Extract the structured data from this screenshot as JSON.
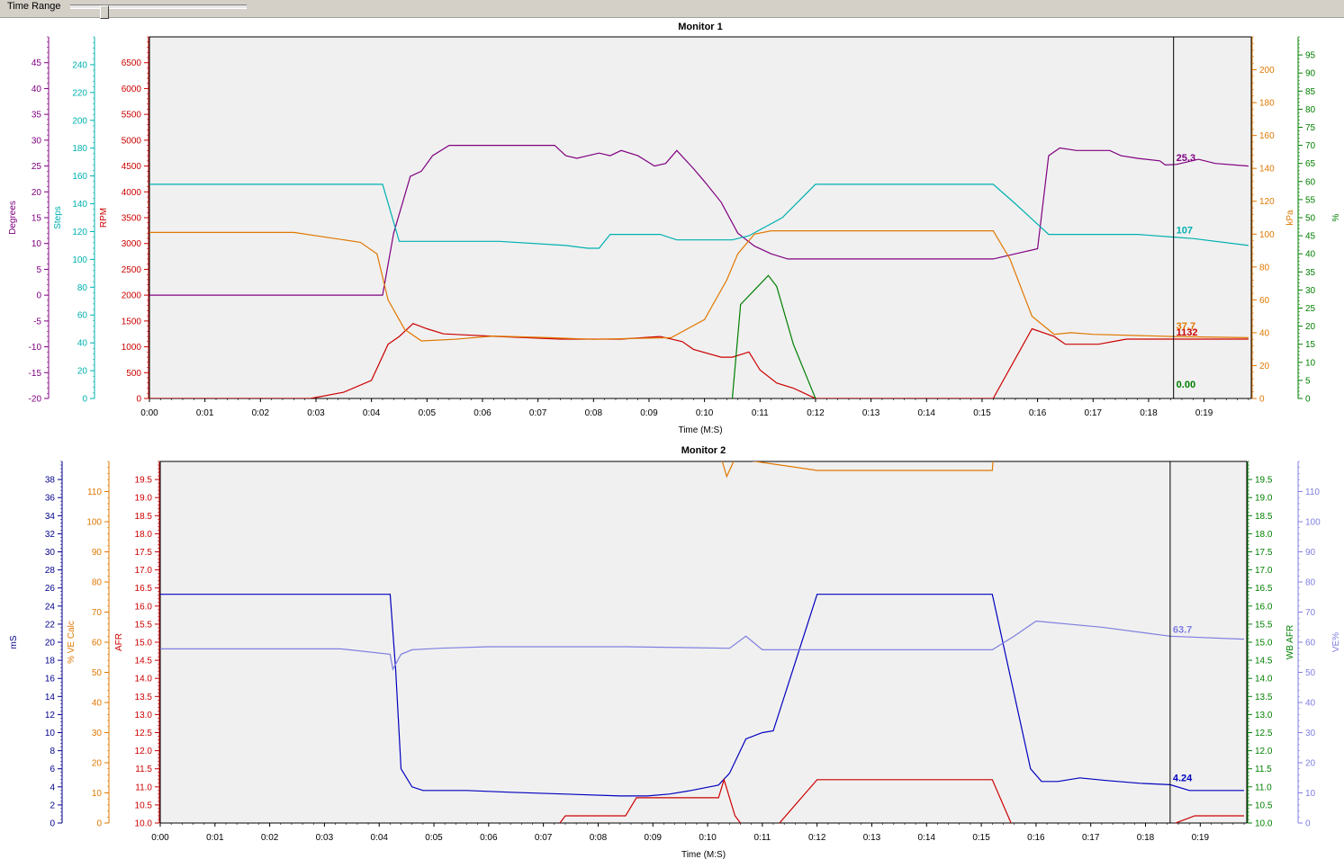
{
  "toolbar": {
    "time_range_label": "Time Range",
    "slider_value": 0.18
  },
  "chart_data": [
    {
      "type": "line",
      "title": "Monitor 1",
      "xlabel": "Time (M:S)",
      "x_ticks": [
        "0:00",
        "0:01",
        "0:02",
        "0:03",
        "0:04",
        "0:05",
        "0:06",
        "0:07",
        "0:08",
        "0:09",
        "0:10",
        "0:11",
        "0:12",
        "0:13",
        "0:14",
        "0:15",
        "0:16",
        "0:17",
        "0:18",
        "0:19"
      ],
      "xlim": [
        0,
        19.85
      ],
      "cursor_x": 18.45,
      "grid": false,
      "axes": [
        {
          "id": "deg",
          "label": "Degrees",
          "side": "left",
          "color": "#800080",
          "min": -20,
          "max": 50,
          "ticks": [
            -20,
            -15,
            -10,
            -5,
            0,
            5,
            10,
            15,
            20,
            25,
            30,
            35,
            40,
            45
          ]
        },
        {
          "id": "steps",
          "label": "Steps",
          "side": "left",
          "color": "#00b0b0",
          "min": 0,
          "max": 260,
          "ticks": [
            0,
            20,
            40,
            60,
            80,
            100,
            120,
            140,
            160,
            180,
            200,
            220,
            240
          ]
        },
        {
          "id": "rpm",
          "label": "RPM",
          "side": "left",
          "color": "#cc0000",
          "min": 0,
          "max": 7000,
          "ticks": [
            0,
            500,
            1000,
            1500,
            2000,
            2500,
            3000,
            3500,
            4000,
            4500,
            5000,
            5500,
            6000,
            6500
          ]
        },
        {
          "id": "kpa",
          "label": "kPa",
          "side": "right",
          "color": "#e07800",
          "min": 0,
          "max": 220,
          "ticks": [
            0,
            20,
            40,
            60,
            80,
            100,
            120,
            140,
            160,
            180,
            200
          ]
        },
        {
          "id": "pct",
          "label": "%",
          "side": "right",
          "color": "#007f00",
          "min": 0,
          "max": 100,
          "ticks": [
            0,
            5,
            10,
            15,
            20,
            25,
            30,
            35,
            40,
            45,
            50,
            55,
            60,
            65,
            70,
            75,
            80,
            85,
            90,
            95
          ]
        }
      ],
      "series": [
        {
          "axis": "deg",
          "color": "#800080",
          "cursor_value": "25.3",
          "cursor_dy": 0,
          "x": [
            0,
            4.2,
            4.4,
            4.7,
            4.9,
            5.1,
            5.4,
            7.3,
            7.5,
            7.7,
            7.9,
            8.1,
            8.3,
            8.5,
            8.8,
            9.1,
            9.3,
            9.5,
            9.8,
            10.0,
            10.3,
            10.6,
            10.9,
            11.2,
            11.5,
            12,
            13,
            14,
            15.2,
            15.6,
            16.0,
            16.2,
            16.4,
            16.7,
            17.3,
            17.5,
            17.8,
            18.2,
            18.3,
            18.5,
            18.9,
            19.2,
            19.8
          ],
          "y": [
            0,
            0,
            12,
            23,
            24,
            27,
            29,
            29,
            27,
            26.5,
            27,
            27.5,
            27,
            28,
            27,
            25,
            25.5,
            28,
            24.5,
            22,
            18,
            12,
            9.5,
            8,
            7,
            7,
            7,
            7,
            7,
            8,
            9,
            27,
            28.5,
            28,
            28,
            27,
            26.5,
            26,
            25.2,
            25.3,
            26.3,
            25.5,
            25
          ]
        },
        {
          "axis": "steps",
          "color": "#00b0b0",
          "cursor_value": "107",
          "cursor_dy": 0,
          "x": [
            0,
            4.2,
            4.5,
            6.3,
            7.5,
            7.9,
            8.1,
            8.3,
            9.2,
            9.5,
            10.5,
            10.8,
            11.4,
            12,
            15.2,
            15.6,
            16.2,
            17.8,
            18.45,
            18.8,
            19.8
          ],
          "y": [
            154,
            154,
            113,
            113,
            110,
            108,
            108,
            118,
            118,
            114,
            114,
            117,
            130,
            154,
            154,
            140,
            118,
            118,
            116,
            115,
            110
          ]
        },
        {
          "axis": "rpm",
          "color": "#cc0000",
          "cursor_value": "1132",
          "cursor_dy": 0,
          "x": [
            0,
            2.9,
            3.5,
            4.0,
            4.3,
            4.5,
            4.75,
            5.0,
            5.3,
            6.3,
            7.4,
            8.5,
            9.2,
            9.6,
            9.8,
            10.3,
            10.5,
            10.8,
            11.0,
            11.3,
            11.6,
            12.0,
            15.2,
            15.9,
            16.3,
            16.5,
            17.1,
            17.6,
            18.45,
            19.8
          ],
          "y": [
            0,
            0,
            120,
            350,
            1050,
            1200,
            1450,
            1350,
            1250,
            1200,
            1150,
            1150,
            1200,
            1100,
            950,
            800,
            800,
            900,
            550,
            300,
            200,
            0,
            0,
            1350,
            1200,
            1050,
            1050,
            1150,
            1150,
            1150
          ]
        },
        {
          "axis": "kpa",
          "color": "#e07800",
          "cursor_value": "37.7",
          "cursor_dy": -4,
          "x": [
            0,
            2.6,
            3.8,
            4.1,
            4.3,
            4.6,
            4.9,
            5.5,
            6.2,
            7.2,
            8.0,
            9.4,
            10.0,
            10.4,
            10.6,
            10.9,
            11.2,
            12,
            15.2,
            15.5,
            15.9,
            16.3,
            16.6,
            17.0,
            18.45,
            19.8
          ],
          "y": [
            101,
            101,
            95,
            88,
            60,
            42,
            35,
            36,
            38,
            37,
            36,
            37,
            48,
            72,
            88,
            100,
            102,
            102,
            102,
            85,
            50,
            39,
            40,
            39,
            37.7,
            37
          ]
        },
        {
          "axis": "pct",
          "color": "#007f00",
          "cursor_value": "0.00",
          "cursor_dy": -6,
          "x": [
            10.5,
            10.65,
            10.9,
            11.15,
            11.3,
            11.6,
            12.0
          ],
          "y": [
            0,
            26,
            30,
            34,
            31,
            15,
            0
          ]
        }
      ]
    },
    {
      "type": "line",
      "title": "Monitor 2",
      "xlabel": "Time (M:S)",
      "x_ticks": [
        "0:00",
        "0:01",
        "0:02",
        "0:03",
        "0:04",
        "0:05",
        "0:06",
        "0:07",
        "0:08",
        "0:09",
        "0:10",
        "0:11",
        "0:12",
        "0:13",
        "0:14",
        "0:15",
        "0:16",
        "0:17",
        "0:18",
        "0:19"
      ],
      "xlim": [
        0,
        19.85
      ],
      "cursor_x": 18.45,
      "grid": false,
      "axes": [
        {
          "id": "ms",
          "label": "mS",
          "side": "left",
          "color": "#00008b",
          "min": 0,
          "max": 40,
          "ticks": [
            0,
            2,
            4,
            6,
            8,
            10,
            12,
            14,
            16,
            18,
            20,
            22,
            24,
            26,
            28,
            30,
            32,
            34,
            36,
            38
          ]
        },
        {
          "id": "vecalc",
          "label": "% VE Calc",
          "side": "left",
          "color": "#e07800",
          "min": 0,
          "max": 120,
          "ticks": [
            0,
            10,
            20,
            30,
            40,
            50,
            60,
            70,
            80,
            90,
            100,
            110
          ]
        },
        {
          "id": "afr",
          "label": "AFR",
          "side": "left",
          "color": "#cc0000",
          "min": 10,
          "max": 20,
          "ticks": [
            10.0,
            10.5,
            11.0,
            11.5,
            12.0,
            12.5,
            13.0,
            13.5,
            14.0,
            14.5,
            15.0,
            15.5,
            16.0,
            16.5,
            17.0,
            17.5,
            18.0,
            18.5,
            19.0,
            19.5
          ]
        },
        {
          "id": "wbafr",
          "label": "WB AFR",
          "side": "right",
          "color": "#007f00",
          "min": 10,
          "max": 20,
          "ticks": [
            10.0,
            10.5,
            11.0,
            11.5,
            12.0,
            12.5,
            13.0,
            13.5,
            14.0,
            14.5,
            15.0,
            15.5,
            16.0,
            16.5,
            17.0,
            17.5,
            18.0,
            18.5,
            19.0,
            19.5
          ]
        },
        {
          "id": "ve",
          "label": "VE%",
          "side": "right",
          "color": "#7f7fe0",
          "min": 0,
          "max": 120,
          "ticks": [
            0,
            10,
            20,
            30,
            40,
            50,
            60,
            70,
            80,
            90,
            100,
            110
          ]
        }
      ],
      "series": [
        {
          "axis": "ms",
          "color": "#0000c0",
          "cursor_value": "4.24",
          "cursor_dy": 0,
          "x": [
            0,
            4.2,
            4.3,
            4.4,
            4.6,
            4.8,
            5.2,
            5.6,
            6.4,
            7.4,
            8.4,
            8.9,
            9.3,
            9.7,
            10.2,
            10.4,
            10.7,
            11.0,
            11.2,
            12,
            15.2,
            15.9,
            16.1,
            16.4,
            16.8,
            17.3,
            17.9,
            18.45,
            18.8,
            19.8
          ],
          "y": [
            25.3,
            25.3,
            17,
            6,
            4,
            3.6,
            3.6,
            3.6,
            3.4,
            3.2,
            3.0,
            3.0,
            3.2,
            3.6,
            4.2,
            5.5,
            9.3,
            10.0,
            10.2,
            25.3,
            25.3,
            6,
            4.6,
            4.6,
            5,
            4.7,
            4.4,
            4.24,
            3.6,
            3.6
          ]
        },
        {
          "axis": "ve",
          "color": "#7f7fe0",
          "cursor_value": "63.7",
          "cursor_dy": 0,
          "x": [
            0,
            3.3,
            4.2,
            4.25,
            4.4,
            4.6,
            5.1,
            6.0,
            8.5,
            10.4,
            10.7,
            11.0,
            12,
            15.2,
            15.6,
            16.0,
            17.2,
            18.45,
            19.8
          ],
          "y": [
            57.8,
            57.8,
            56,
            51,
            56,
            57.5,
            58,
            58.5,
            58.5,
            58,
            62,
            57.5,
            57.5,
            57.5,
            62,
            67,
            65,
            62,
            61
          ]
        },
        {
          "axis": "afr",
          "color": "#cc0000",
          "cursor_value": "",
          "cursor_dy": 0,
          "x": [
            0,
            7.2,
            7.4,
            8.5,
            8.7,
            10.2,
            10.3,
            10.5,
            10.7,
            11.2,
            12,
            15.2,
            15.6,
            16.2,
            18.2,
            18.9,
            19.8
          ],
          "y": [
            9.8,
            9.8,
            10.2,
            10.2,
            10.7,
            10.7,
            11.2,
            10.2,
            9.8,
            9.8,
            11.2,
            11.2,
            9.8,
            9.8,
            9.8,
            10.2,
            10.2
          ]
        }
      ],
      "offscale_series": {
        "axis": "vecalc",
        "color": "#e07800",
        "x": [
          10.1,
          10.25,
          10.35,
          10.5,
          12.0,
          15.2,
          15.3
        ],
        "y": [
          140,
          121,
          115,
          121,
          117,
          117,
          140
        ]
      }
    }
  ]
}
